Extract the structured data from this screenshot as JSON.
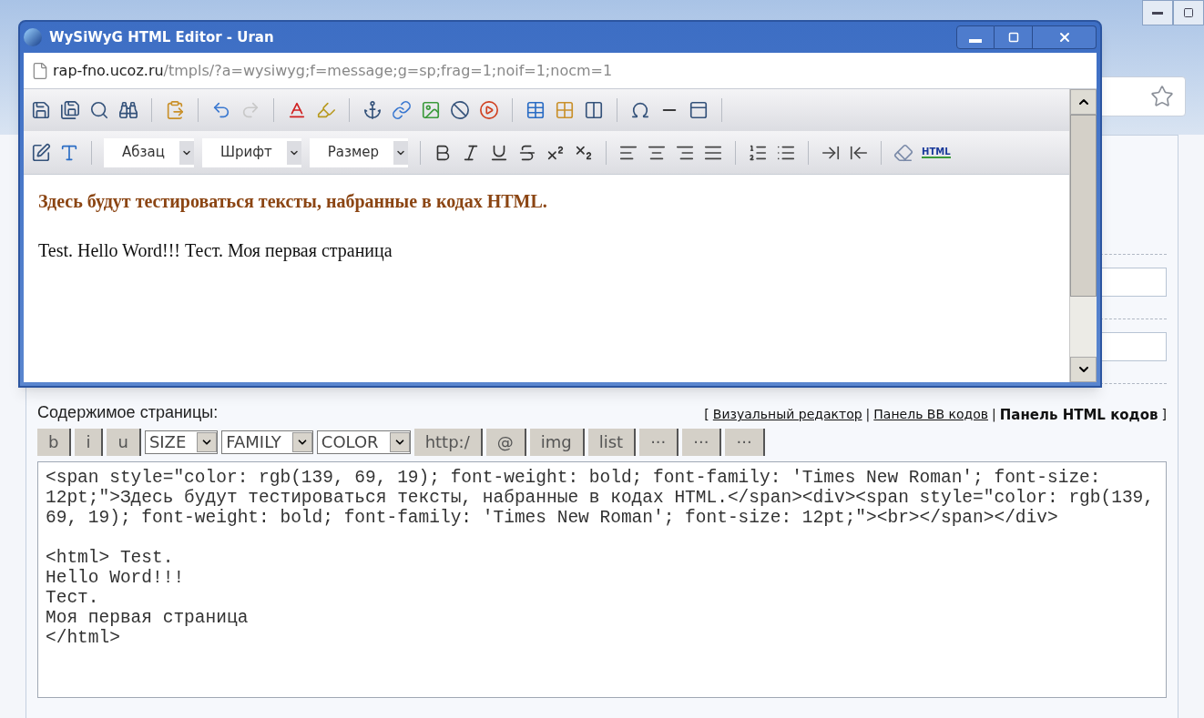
{
  "window": {
    "title": "WySiWyG HTML Editor - Uran",
    "url_host": "rap-fno.ucoz.ru",
    "url_path": "/tmpls/?a=wysiwyg;f=message;g=sp;frag=1;noif=1;nocm=1"
  },
  "editor": {
    "dropdowns": [
      {
        "label": "Абзац"
      },
      {
        "label": "Шрифт"
      },
      {
        "label": "Размер"
      }
    ],
    "html_button": "HTML",
    "paragraphs": [
      {
        "kind": "heading",
        "text": "Здесь будут тестироваться тексты, набранные в кодах HTML."
      },
      {
        "kind": "plain",
        "text": "Test. Hello Word!!! Тест. Моя первая страница"
      }
    ]
  },
  "page": {
    "content_label": "Содержимое страницы:",
    "mode_open": "[",
    "mode_separator": "|",
    "mode_close": "]",
    "modes": [
      {
        "label": "Визуальный редактор",
        "selected": false
      },
      {
        "label": "Панель BB кодов",
        "selected": false
      },
      {
        "label": "Панель HTML кодов",
        "selected": true
      }
    ],
    "bb_tools": [
      {
        "kind": "button",
        "label": "b"
      },
      {
        "kind": "button",
        "label": "i"
      },
      {
        "kind": "button",
        "label": "u"
      },
      {
        "kind": "select",
        "label": "SIZE"
      },
      {
        "kind": "select",
        "label": "FAMILY"
      },
      {
        "kind": "select",
        "label": "COLOR"
      },
      {
        "kind": "button",
        "label": "http:/"
      },
      {
        "kind": "button",
        "label": "@"
      },
      {
        "kind": "button",
        "label": "img"
      },
      {
        "kind": "button",
        "label": "list"
      },
      {
        "kind": "button",
        "label": "···"
      },
      {
        "kind": "button",
        "label": "···"
      },
      {
        "kind": "button",
        "label": "···"
      }
    ],
    "code_blocks": [
      [
        "<span style=\"color: rgb(139, 69, 19); font-weight: bold; font-family: 'Times New Roman'; font-size:",
        "12pt;\">Здесь будут тестироваться тексты, набранные в кодах HTML.</span><div><span style=\"color: rgb(139,",
        "69, 19); font-weight: bold; font-family: 'Times New Roman'; font-size: 12pt;\"><br></span></div>"
      ],
      [
        "<html> Test.",
        "Hello Word!!!",
        "Тест.",
        "Моя первая страница",
        "</html>"
      ]
    ]
  }
}
